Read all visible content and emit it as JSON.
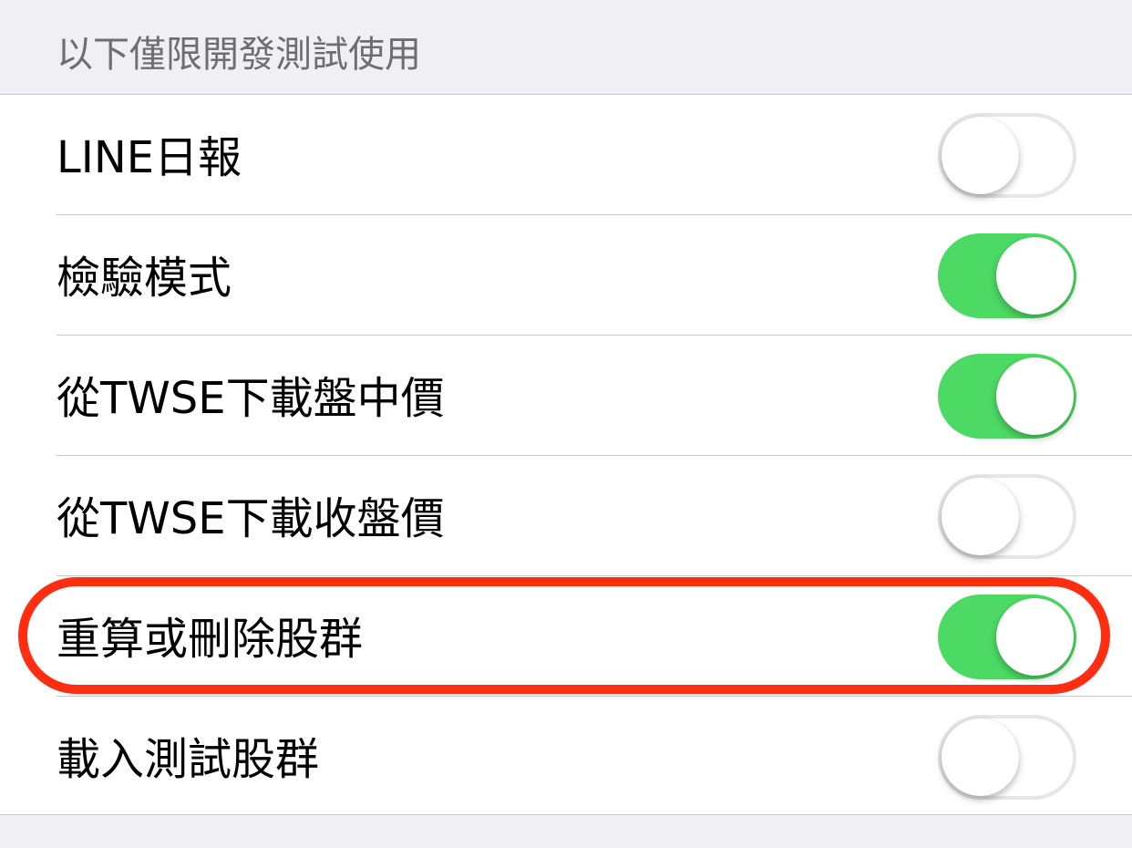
{
  "section": {
    "header": "以下僅限開發測試使用"
  },
  "rows": [
    {
      "label": "LINE日報",
      "on": false
    },
    {
      "label": "檢驗模式",
      "on": true
    },
    {
      "label": "從TWSE下載盤中價",
      "on": true
    },
    {
      "label": "從TWSE下載收盤價",
      "on": false
    },
    {
      "label": "重算或刪除股群",
      "on": true
    },
    {
      "label": "載入測試股群",
      "on": false
    }
  ],
  "colors": {
    "switch_on": "#4cd964",
    "highlight": "#ff2d12",
    "background": "#efeff4"
  }
}
